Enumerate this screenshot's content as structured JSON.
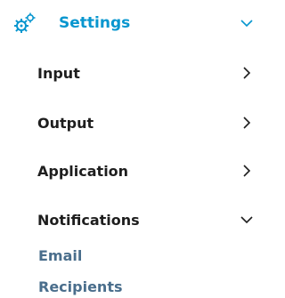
{
  "header": {
    "label": "Settings",
    "icon": "gears-icon",
    "state": "expanded"
  },
  "items": [
    {
      "label": "Input",
      "state": "collapsed"
    },
    {
      "label": "Output",
      "state": "collapsed"
    },
    {
      "label": "Application",
      "state": "collapsed"
    },
    {
      "label": "Notifications",
      "state": "expanded"
    }
  ],
  "notifications_children": [
    {
      "label": "Email"
    },
    {
      "label": "Recipients"
    }
  ],
  "colors": {
    "accent": "#0796cf",
    "text": "#1e1e1e",
    "link": "#4a6e8c",
    "chevron": "#1e1e1e"
  }
}
